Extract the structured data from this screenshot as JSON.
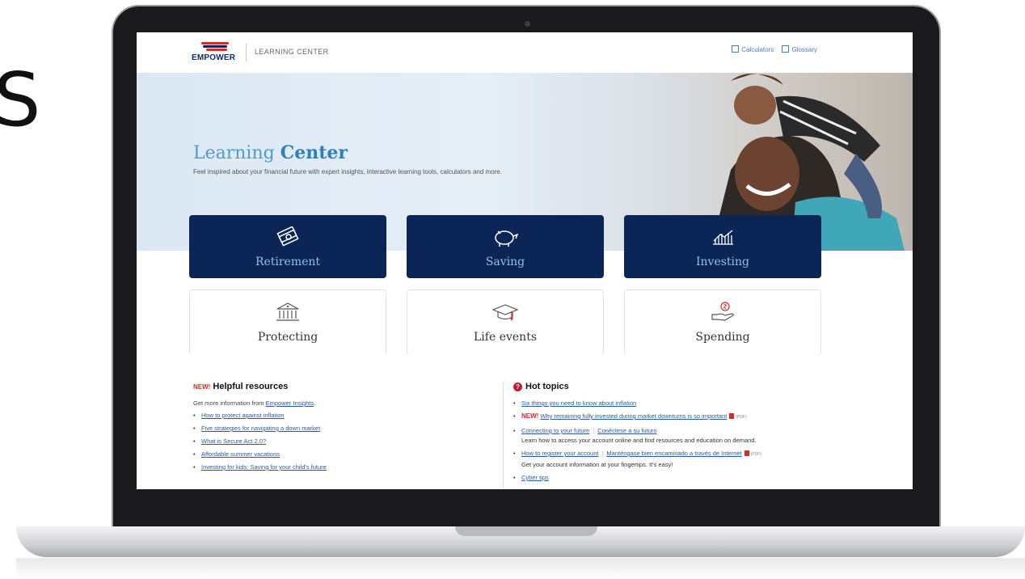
{
  "edge_letter": "S",
  "header": {
    "brand": "EMPOWER",
    "section": "LEARNING CENTER",
    "links": [
      {
        "icon": "calculator-icon",
        "label": "Calculators"
      },
      {
        "icon": "book-icon",
        "label": "Glossary"
      }
    ]
  },
  "hero": {
    "title_light": "Learning",
    "title_bold": "Center",
    "subtitle": "Feel inspired about your financial future with expert insights, interactive learning tools, calculators and more."
  },
  "tiles": [
    {
      "label": "Retirement",
      "icon": "money-stack-icon"
    },
    {
      "label": "Saving",
      "icon": "piggy-bank-icon"
    },
    {
      "label": "Investing",
      "icon": "bar-chart-icon"
    },
    {
      "label": "Protecting",
      "icon": "bank-building-icon"
    },
    {
      "label": "Life events",
      "icon": "graduation-cap-icon"
    },
    {
      "label": "Spending",
      "icon": "hand-coin-icon"
    }
  ],
  "helpful": {
    "new_tag": "NEW!",
    "title": "Helpful resources",
    "intro_prefix": "Get more information from ",
    "intro_link": "Empower Insights",
    "intro_suffix": ".",
    "items": [
      "How to protect against inflation",
      "Five strategies for navigating a down market",
      "What is Secure Act 2.0?",
      "Affordable summer vacations",
      "Investing for kids: Saving for your child's future"
    ]
  },
  "hot": {
    "title": "Hot topics",
    "item1": "Six things you need to know about inflation",
    "item2_new": "NEW!",
    "item2": "Why remaining fully invested during market downturns is so important",
    "pdf": "(PDF)",
    "item3a": "Connecting to your future",
    "item3b": "Conéctese a su futuro",
    "item3_desc": "Learn how to access your account online and find resources and education on demand.",
    "item4a": "How to register your account",
    "item4b": "Manténgase bien encaminado a través de Internet",
    "item4_desc": "Get your account information at your fingertips. It's easy!",
    "item5": "Cyber tips"
  },
  "colors": {
    "navy": "#0c2557",
    "tile_text": "#8fc0e6",
    "link": "#2b5aa0",
    "accent_red": "#d62b2b"
  }
}
